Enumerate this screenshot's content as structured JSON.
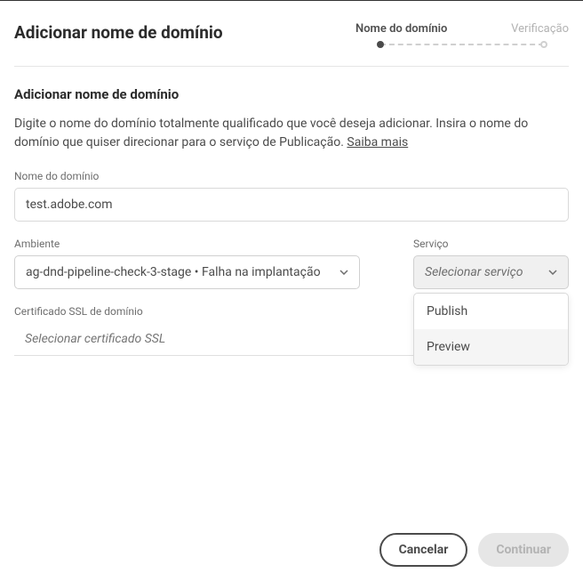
{
  "header": {
    "title": "Adicionar nome de domínio",
    "steps": [
      {
        "label": "Nome do domínio",
        "active": true
      },
      {
        "label": "Verificação",
        "active": false
      }
    ]
  },
  "section": {
    "title": "Adicionar nome de domínio",
    "description_1": "Digite o nome do domínio totalmente qualificado que você deseja adicionar. Insira o nome do domínio que quiser direcionar para o serviço de Publicação. ",
    "learn_more": "Saiba mais"
  },
  "fields": {
    "domain": {
      "label": "Nome do domínio",
      "value": "test.adobe.com"
    },
    "environment": {
      "label": "Ambiente",
      "value": "ag-dnd-pipeline-check-3-stage • Falha na implantação"
    },
    "service": {
      "label": "Serviço",
      "placeholder": "Selecionar serviço",
      "options": [
        "Publish",
        "Preview"
      ]
    },
    "ssl": {
      "label": "Certificado SSL de domínio",
      "placeholder": "Selecionar certificado SSL"
    }
  },
  "footer": {
    "cancel": "Cancelar",
    "continue": "Continuar"
  }
}
